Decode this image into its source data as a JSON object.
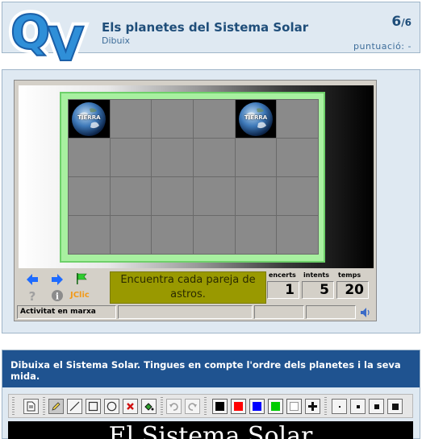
{
  "header": {
    "logo_text": "QV",
    "title": "Els planetes del Sistema Solar",
    "subtitle": "Dibuix",
    "counter_current": "6",
    "counter_total": "/6",
    "score_label": "puntuació:",
    "score_value": "-"
  },
  "activity": {
    "card_label": "TIERRA",
    "revealed_cells": [
      0,
      4
    ],
    "message": "Encuentra cada pareja de astros.",
    "counters": [
      {
        "label": "encerts",
        "value": "1"
      },
      {
        "label": "intents",
        "value": "5"
      },
      {
        "label": "temps",
        "value": "20"
      }
    ],
    "controls": {
      "back_icon": "arrow-left-icon",
      "forward_icon": "arrow-right-icon",
      "restart_icon": "green-flag-icon",
      "help_icon": "question-icon",
      "info_icon": "info-icon",
      "brand": "JClic"
    },
    "status": "Activitat en marxa",
    "sound_icon": "speaker-icon"
  },
  "task": {
    "instruction": "Dibuixa el Sistema Solar. Tingues en compte l'ordre dels planetes i la seva mida.",
    "colors": [
      "#000000",
      "#ff0000",
      "#0000ff",
      "#00cc00",
      "#ffffff"
    ],
    "canvas_title": "El Sistema Solar"
  }
}
